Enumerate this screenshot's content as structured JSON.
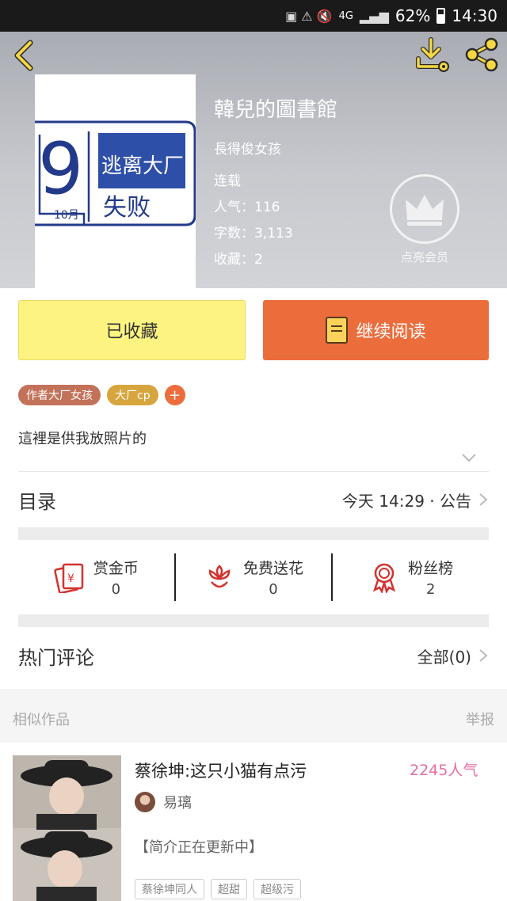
{
  "status_bar": {
    "battery": "62%",
    "time": "14:30",
    "network": "4G"
  },
  "book": {
    "title": "韓兒的圖書館",
    "author": "長得俊女孩",
    "status": "连载",
    "popularity_label": "人气：116",
    "word_count_label": "字数：3,113",
    "favorites_label": "收藏：2",
    "cover_text": {
      "num": "9",
      "month": "10月",
      "line1": "逃离大厂",
      "line2": "失败"
    }
  },
  "vip": {
    "label": "点亮会员"
  },
  "actions": {
    "favorited_label": "已收藏",
    "continue_label": "继续阅读"
  },
  "tags": {
    "author_tag": "作者大厂女孩",
    "cp_tag": "大厂cp",
    "add": "+"
  },
  "intro": {
    "text": "這裡是供我放照片的"
  },
  "catalog": {
    "title": "目录",
    "latest": "今天 14:29 · 公告"
  },
  "stats": [
    {
      "icon": "red-envelope-icon",
      "label": "赏金币",
      "value": "0"
    },
    {
      "icon": "flower-icon",
      "label": "免费送花",
      "value": "0"
    },
    {
      "icon": "medal-icon",
      "label": "粉丝榜",
      "value": "2"
    }
  ],
  "comments": {
    "title": "热门评论",
    "all_label": "全部(0)"
  },
  "similar": {
    "header": "相似作品",
    "report": "举报",
    "item": {
      "title": "蔡徐坤:这只小猫有点污",
      "popularity": "2245人气",
      "author": "易璃",
      "intro": "【简介正在更新中】",
      "tags": [
        "蔡徐坤同人",
        "超甜",
        "超级污"
      ]
    }
  },
  "colors": {
    "accent_orange": "#ec6d3c",
    "fav_yellow": "#fdf381",
    "icon_yellow": "#f5d742",
    "stat_red": "#d3322f",
    "pop_pink": "#e66da4"
  }
}
